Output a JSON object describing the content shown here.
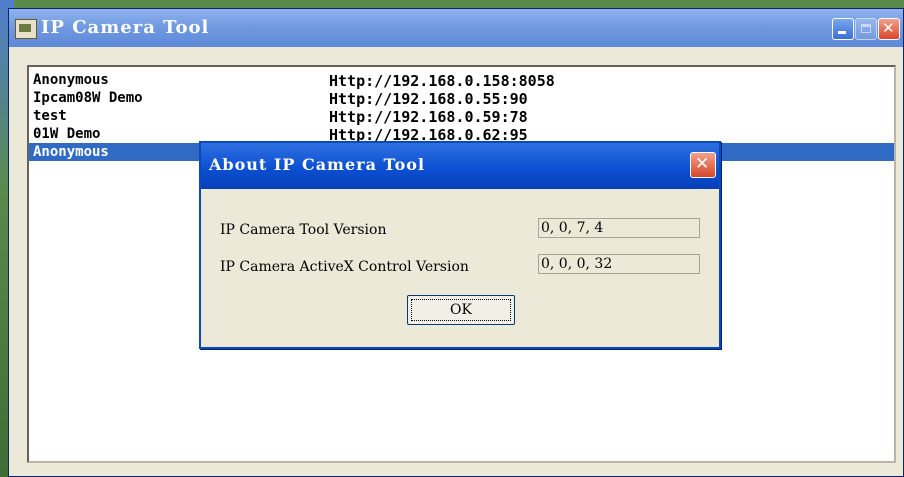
{
  "window": {
    "title": "IP Camera Tool"
  },
  "devices": [
    {
      "name": "Anonymous",
      "url": "Http://192.168.0.158:8058"
    },
    {
      "name": "Ipcam08W Demo",
      "url": "Http://192.168.0.55:90"
    },
    {
      "name": "test",
      "url": "Http://192.168.0.59:78"
    },
    {
      "name": "01W Demo",
      "url": "Http://192.168.0.62:95"
    },
    {
      "name": "Anonymous",
      "url": ""
    }
  ],
  "selected_index": 4,
  "dialog": {
    "title": "About IP Camera Tool",
    "tool_version_label": "IP Camera Tool Version",
    "tool_version_value": "0, 0, 7, 4",
    "activex_version_label": "IP Camera ActiveX Control Version",
    "activex_version_value": "0, 0, 0, 32",
    "ok_label": "OK"
  }
}
